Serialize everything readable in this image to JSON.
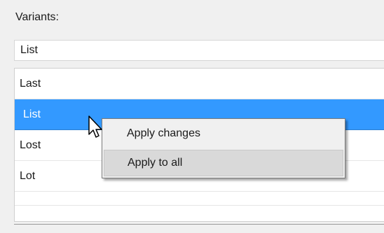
{
  "variants_label": "Variants:",
  "combo": {
    "value": "List"
  },
  "list": {
    "items": [
      {
        "label": "Last",
        "selected": false
      },
      {
        "label": "List",
        "selected": true
      },
      {
        "label": "Lost",
        "selected": false
      },
      {
        "label": "Lot",
        "selected": false
      },
      {
        "label": "",
        "selected": false
      }
    ]
  },
  "context_menu": {
    "items": [
      {
        "label": "Apply changes"
      },
      {
        "label": "Apply to all"
      }
    ]
  },
  "colors": {
    "selection": "#3399ff",
    "window_bg": "#f0f0f0",
    "hover": "#d9d9d9"
  },
  "icons": {
    "cursor": "arrow-cursor-icon"
  }
}
